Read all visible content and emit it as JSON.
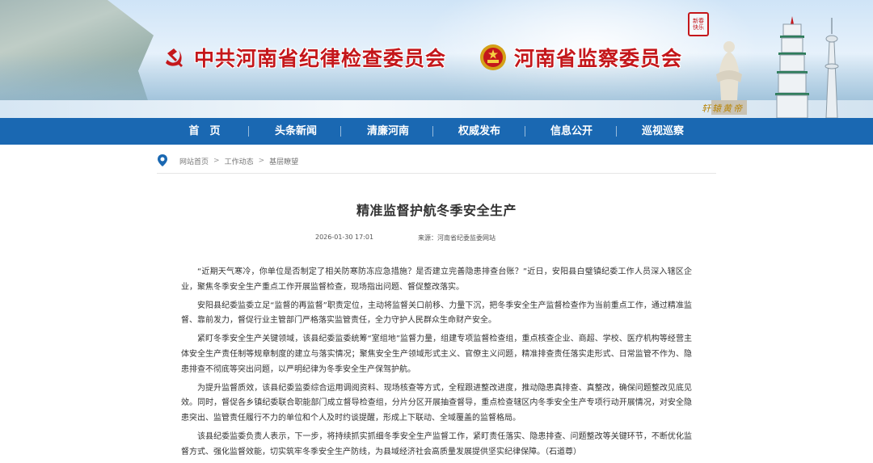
{
  "banner": {
    "title_cpc": "中共河南省纪律检查委员会",
    "title_sup": "河南省监察委员会",
    "seal_text": "新春 快乐",
    "calligraphy": "轩辕黄帝",
    "colors": {
      "title_red": "#c4171b",
      "nav_blue": "#1a68b2"
    }
  },
  "nav": {
    "items": [
      {
        "label": "首　页"
      },
      {
        "label": "头条新闻"
      },
      {
        "label": "清廉河南"
      },
      {
        "label": "权威发布"
      },
      {
        "label": "信息公开"
      },
      {
        "label": "巡视巡察"
      }
    ]
  },
  "breadcrumb": {
    "icon": "location-pin-icon",
    "items": [
      "网站首页",
      "工作动态",
      "基层瞭望"
    ],
    "separator": ">"
  },
  "article": {
    "title": "精准监督护航冬季安全生产",
    "date": "2026-01-30 17:01",
    "source": "来源：河南省纪委监委网站",
    "paragraphs": [
      "“近期天气寒冷，你单位是否制定了相关防寒防冻应急措施？是否建立完善隐患排查台账？”近日，安阳县白璧镇纪委工作人员深入辖区企业，聚焦冬季安全生产重点工作开展监督检查，现场指出问题、督促整改落实。",
      "安阳县纪委监委立足“监督的再监督”职责定位，主动将监督关口前移、力量下沉，把冬季安全生产监督检查作为当前重点工作，通过精准监督、靠前发力，督促行业主管部门严格落实监管责任，全力守护人民群众生命财产安全。",
      "紧盯冬季安全生产关键领域，该县纪委监委统筹“室组地”监督力量，组建专项监督检查组，重点核查企业、商超、学校、医疗机构等经营主体安全生产责任制等规章制度的建立与落实情况；聚焦安全生产领域形式主义、官僚主义问题，精准排查责任落实走形式、日常监管不作为、隐患排查不彻底等突出问题，以严明纪律为冬季安全生产保驾护航。",
      "为提升监督质效，该县纪委监委综合运用调阅资料、现场核查等方式，全程跟进整改进度，推动隐患真排查、真整改，确保问题整改见底见效。同时，督促各乡镇纪委联合职能部门成立督导检查组，分片分区开展抽查督导，重点检查辖区内冬季安全生产专项行动开展情况，对安全隐患突出、监管责任履行不力的单位和个人及时约谈提醒，形成上下联动、全域覆盖的监督格局。",
      "该县纪委监委负责人表示，下一步，将持续抓实抓细冬季安全生产监督工作，紧盯责任落实、隐患排查、问题整改等关键环节，不断优化监督方式、强化监督效能，切实筑牢冬季安全生产防线，为县域经济社会高质量发展提供坚实纪律保障。（石道尊）"
    ]
  }
}
